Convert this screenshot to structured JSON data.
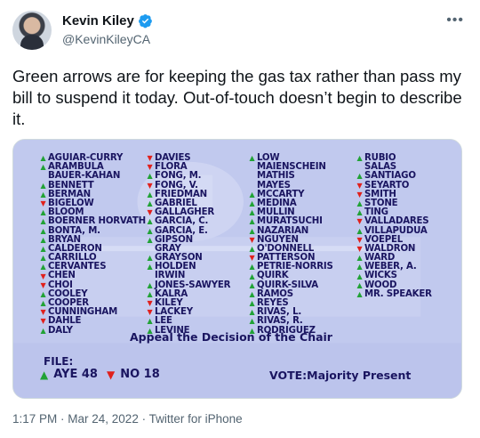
{
  "tweet": {
    "display_name": "Kevin Kiley",
    "handle": "@KevinKileyCA",
    "verified_icon": "verified-badge-icon",
    "more_icon": "more-options-icon",
    "text": "Green arrows are for keeping the gas tax rather than pass my bill to suspend it today. Out-of-touch doesn’t begin to describe it.",
    "timestamp": "1:17 PM · Mar 24, 2022 · Twitter for iPhone"
  },
  "colors": {
    "aye": "#21a236",
    "no": "#e0201c",
    "board_text": "#1a1560",
    "verified": "#1d9bf0"
  },
  "board": {
    "columns": [
      [
        {
          "name": "AGUIAR-CURRY",
          "vote": "aye"
        },
        {
          "name": "ARAMBULA",
          "vote": "aye"
        },
        {
          "name": "BAUER-KAHAN",
          "vote": "none"
        },
        {
          "name": "BENNETT",
          "vote": "aye"
        },
        {
          "name": "BERMAN",
          "vote": "aye"
        },
        {
          "name": "BIGELOW",
          "vote": "no"
        },
        {
          "name": "BLOOM",
          "vote": "aye"
        },
        {
          "name": "BOERNER HORVATH",
          "vote": "aye"
        },
        {
          "name": "BONTA, M.",
          "vote": "aye"
        },
        {
          "name": "BRYAN",
          "vote": "aye"
        },
        {
          "name": "CALDERON",
          "vote": "aye"
        },
        {
          "name": "CARRILLO",
          "vote": "aye"
        },
        {
          "name": "CERVANTES",
          "vote": "aye"
        },
        {
          "name": "CHEN",
          "vote": "no"
        },
        {
          "name": "CHOI",
          "vote": "no"
        },
        {
          "name": "COOLEY",
          "vote": "aye"
        },
        {
          "name": "COOPER",
          "vote": "aye"
        },
        {
          "name": "CUNNINGHAM",
          "vote": "no"
        },
        {
          "name": "DAHLE",
          "vote": "no"
        },
        {
          "name": "DALY",
          "vote": "aye"
        }
      ],
      [
        {
          "name": "DAVIES",
          "vote": "no"
        },
        {
          "name": "FLORA",
          "vote": "no"
        },
        {
          "name": "FONG, M.",
          "vote": "aye"
        },
        {
          "name": "FONG, V.",
          "vote": "no"
        },
        {
          "name": "FRIEDMAN",
          "vote": "aye"
        },
        {
          "name": "GABRIEL",
          "vote": "aye"
        },
        {
          "name": "GALLAGHER",
          "vote": "no"
        },
        {
          "name": "GARCIA, C.",
          "vote": "aye"
        },
        {
          "name": "GARCIA, E.",
          "vote": "aye"
        },
        {
          "name": "GIPSON",
          "vote": "aye"
        },
        {
          "name": "GRAY",
          "vote": "none"
        },
        {
          "name": "GRAYSON",
          "vote": "aye"
        },
        {
          "name": "HOLDEN",
          "vote": "aye"
        },
        {
          "name": "IRWIN",
          "vote": "none"
        },
        {
          "name": "JONES-SAWYER",
          "vote": "aye"
        },
        {
          "name": "KALRA",
          "vote": "aye"
        },
        {
          "name": "KILEY",
          "vote": "no"
        },
        {
          "name": "LACKEY",
          "vote": "no"
        },
        {
          "name": "LEE",
          "vote": "aye"
        },
        {
          "name": "LEVINE",
          "vote": "aye"
        }
      ],
      [
        {
          "name": "LOW",
          "vote": "aye"
        },
        {
          "name": "MAIENSCHEIN",
          "vote": "none"
        },
        {
          "name": "MATHIS",
          "vote": "none"
        },
        {
          "name": "MAYES",
          "vote": "none"
        },
        {
          "name": "MCCARTY",
          "vote": "aye"
        },
        {
          "name": "MEDINA",
          "vote": "aye"
        },
        {
          "name": "MULLIN",
          "vote": "aye"
        },
        {
          "name": "MURATSUCHI",
          "vote": "aye"
        },
        {
          "name": "NAZARIAN",
          "vote": "aye"
        },
        {
          "name": "NGUYEN",
          "vote": "no"
        },
        {
          "name": "O'DONNELL",
          "vote": "aye"
        },
        {
          "name": "PATTERSON",
          "vote": "no"
        },
        {
          "name": "PETRIE-NORRIS",
          "vote": "aye"
        },
        {
          "name": "QUIRK",
          "vote": "aye"
        },
        {
          "name": "QUIRK-SILVA",
          "vote": "aye"
        },
        {
          "name": "RAMOS",
          "vote": "aye"
        },
        {
          "name": "REYES",
          "vote": "aye"
        },
        {
          "name": "RIVAS, L.",
          "vote": "aye"
        },
        {
          "name": "RIVAS, R.",
          "vote": "aye"
        },
        {
          "name": "RODRIGUEZ",
          "vote": "aye"
        }
      ],
      [
        {
          "name": "RUBIO",
          "vote": "aye"
        },
        {
          "name": "SALAS",
          "vote": "none"
        },
        {
          "name": "SANTIAGO",
          "vote": "aye"
        },
        {
          "name": "SEYARTO",
          "vote": "no"
        },
        {
          "name": "SMITH",
          "vote": "no"
        },
        {
          "name": "STONE",
          "vote": "aye"
        },
        {
          "name": "TING",
          "vote": "aye"
        },
        {
          "name": "VALLADARES",
          "vote": "no"
        },
        {
          "name": "VILLAPUDUA",
          "vote": "aye"
        },
        {
          "name": "VOEPEL",
          "vote": "no"
        },
        {
          "name": "WALDRON",
          "vote": "no"
        },
        {
          "name": "WARD",
          "vote": "aye"
        },
        {
          "name": "WEBER, A.",
          "vote": "aye"
        },
        {
          "name": "WICKS",
          "vote": "aye"
        },
        {
          "name": "WOOD",
          "vote": "aye"
        },
        {
          "name": "MR. SPEAKER",
          "vote": "aye"
        }
      ]
    ],
    "motion": "Appeal the Decision of the Chair",
    "file_label": "FILE:",
    "aye_label": "AYE 48",
    "no_label": "NO 18",
    "vote_type": "VOTE:Majority Present"
  }
}
